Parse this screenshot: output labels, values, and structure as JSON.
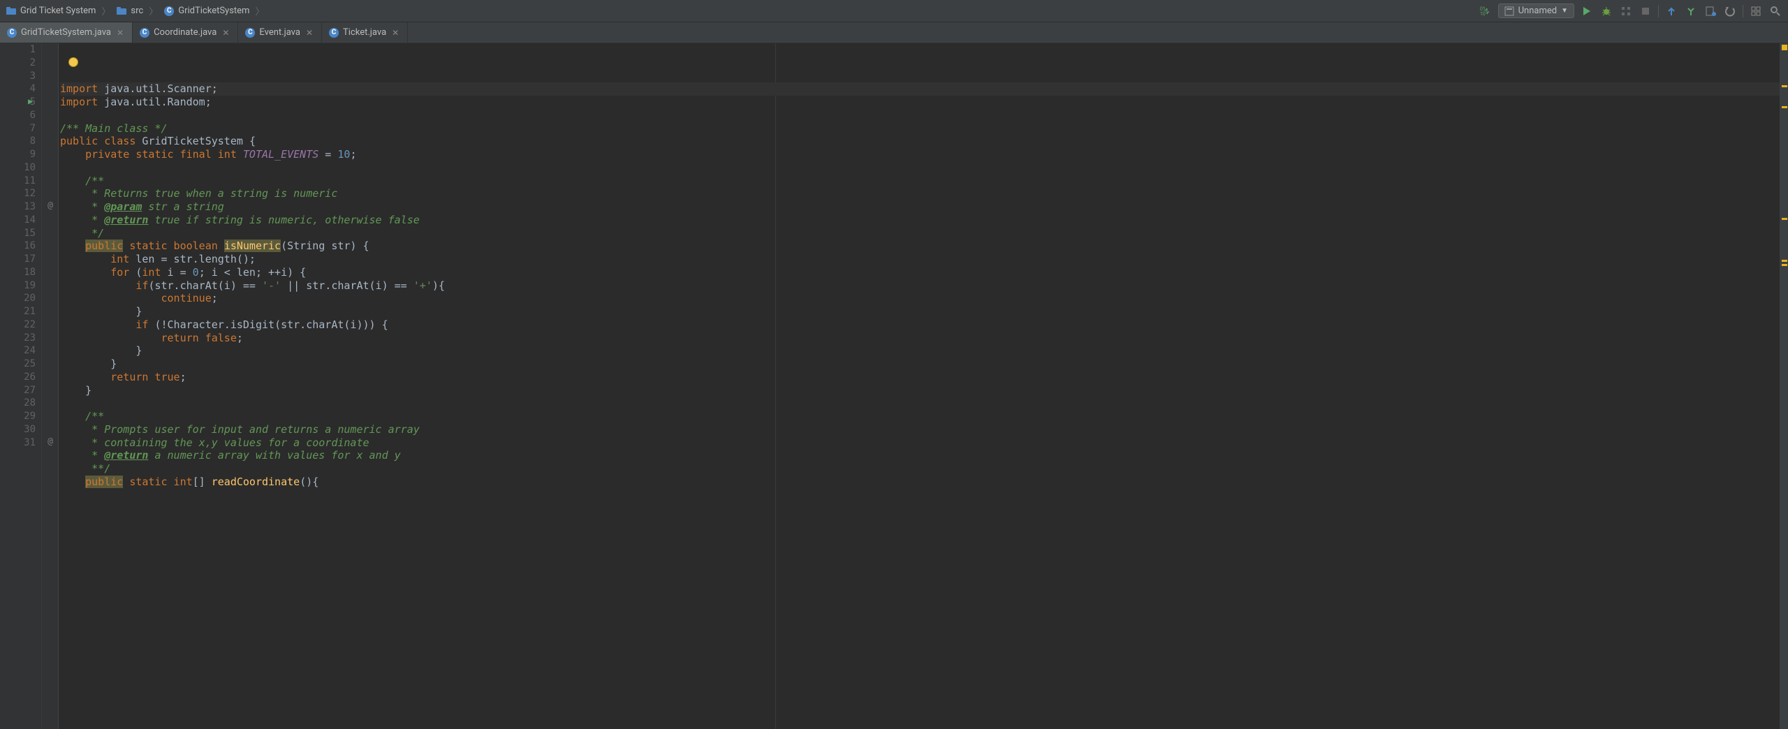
{
  "breadcrumbs": [
    {
      "icon": "project-folder-icon",
      "label": "Grid Ticket System"
    },
    {
      "icon": "folder-icon",
      "label": "src"
    },
    {
      "icon": "class-icon",
      "label": "GridTicketSystem"
    }
  ],
  "runConfig": {
    "label": "Unnamed"
  },
  "tabs": [
    {
      "label": "GridTicketSystem.java",
      "active": true
    },
    {
      "label": "Coordinate.java",
      "active": false
    },
    {
      "label": "Event.java",
      "active": false
    },
    {
      "label": "Ticket.java",
      "active": false
    }
  ],
  "gutter": {
    "lines": 31,
    "at_marks": [
      13,
      31
    ],
    "run_mark": 5
  },
  "code": [
    [
      [
        "kw",
        "import"
      ],
      [
        "ident",
        " java.util.Scanner"
      ],
      [
        "ident",
        ";"
      ]
    ],
    [
      [
        "kw",
        "import"
      ],
      [
        "ident",
        " java.util.Random"
      ],
      [
        "ident",
        ";"
      ]
    ],
    [],
    [
      [
        "doc",
        "/** Main class */"
      ]
    ],
    [
      [
        "kw",
        "public class "
      ],
      [
        "ident",
        "GridTicketSystem "
      ],
      [
        "ident",
        "{"
      ]
    ],
    [
      [
        "ident",
        "    "
      ],
      [
        "kw",
        "private static final int "
      ],
      [
        "field-static",
        "TOTAL_EVENTS"
      ],
      [
        "ident",
        " = "
      ],
      [
        "num",
        "10"
      ],
      [
        "ident",
        ";"
      ]
    ],
    [],
    [
      [
        "ident",
        "    "
      ],
      [
        "doc",
        "/**"
      ]
    ],
    [
      [
        "ident",
        "    "
      ],
      [
        "doc",
        " * Returns true when a string is numeric"
      ]
    ],
    [
      [
        "ident",
        "    "
      ],
      [
        "doc",
        " * "
      ],
      [
        "doc-tag",
        "@param"
      ],
      [
        "doc",
        " str a string"
      ]
    ],
    [
      [
        "ident",
        "    "
      ],
      [
        "doc",
        " * "
      ],
      [
        "doc-tag",
        "@return"
      ],
      [
        "doc",
        " true if string is numeric, otherwise false"
      ]
    ],
    [
      [
        "ident",
        "    "
      ],
      [
        "doc",
        " */"
      ]
    ],
    [
      [
        "ident",
        "    "
      ],
      [
        "kw hl",
        "public"
      ],
      [
        "ident",
        " "
      ],
      [
        "kw",
        "static boolean "
      ],
      [
        "method hl",
        "isNumeric"
      ],
      [
        "ident",
        "(String str) {"
      ]
    ],
    [
      [
        "ident",
        "        "
      ],
      [
        "kw",
        "int "
      ],
      [
        "ident",
        "len = str.length();"
      ]
    ],
    [
      [
        "ident",
        "        "
      ],
      [
        "kw",
        "for "
      ],
      [
        "ident",
        "("
      ],
      [
        "kw",
        "int "
      ],
      [
        "ident",
        "i = "
      ],
      [
        "num",
        "0"
      ],
      [
        "ident",
        "; i < len; ++i) {"
      ]
    ],
    [
      [
        "ident",
        "            "
      ],
      [
        "kw",
        "if"
      ],
      [
        "ident",
        "(str.charAt(i) == "
      ],
      [
        "str",
        "'-'"
      ],
      [
        "ident",
        " || str.charAt(i) == "
      ],
      [
        "str",
        "'+'"
      ],
      [
        "ident",
        "){"
      ]
    ],
    [
      [
        "ident",
        "                "
      ],
      [
        "kw",
        "continue"
      ],
      [
        "ident",
        ";"
      ]
    ],
    [
      [
        "ident",
        "            }"
      ]
    ],
    [
      [
        "ident",
        "            "
      ],
      [
        "kw",
        "if "
      ],
      [
        "ident",
        "(!Character."
      ],
      [
        "ident",
        "isDigit"
      ],
      [
        "ident",
        "(str.charAt(i))) {"
      ]
    ],
    [
      [
        "ident",
        "                "
      ],
      [
        "kw",
        "return false"
      ],
      [
        "ident",
        ";"
      ]
    ],
    [
      [
        "ident",
        "            }"
      ]
    ],
    [
      [
        "ident",
        "        }"
      ]
    ],
    [
      [
        "ident",
        "        "
      ],
      [
        "kw",
        "return true"
      ],
      [
        "ident",
        ";"
      ]
    ],
    [
      [
        "ident",
        "    }"
      ]
    ],
    [],
    [
      [
        "ident",
        "    "
      ],
      [
        "doc",
        "/**"
      ]
    ],
    [
      [
        "ident",
        "    "
      ],
      [
        "doc",
        " * Prompts user for input and returns a numeric array"
      ]
    ],
    [
      [
        "ident",
        "    "
      ],
      [
        "doc",
        " * containing the x,y values for a coordinate"
      ]
    ],
    [
      [
        "ident",
        "    "
      ],
      [
        "doc",
        " * "
      ],
      [
        "doc-tag",
        "@return"
      ],
      [
        "doc",
        " a numeric array with values for x and y"
      ]
    ],
    [
      [
        "ident",
        "    "
      ],
      [
        "doc",
        " **/"
      ]
    ],
    [
      [
        "ident",
        "    "
      ],
      [
        "kw hl",
        "public"
      ],
      [
        "ident",
        " "
      ],
      [
        "kw",
        "static int"
      ],
      [
        "ident",
        "[] "
      ],
      [
        "method",
        "readCoordinate"
      ],
      [
        "ident",
        "(){"
      ]
    ]
  ],
  "icons": {
    "updown": "↕",
    "run": "▶",
    "stop": "■"
  }
}
